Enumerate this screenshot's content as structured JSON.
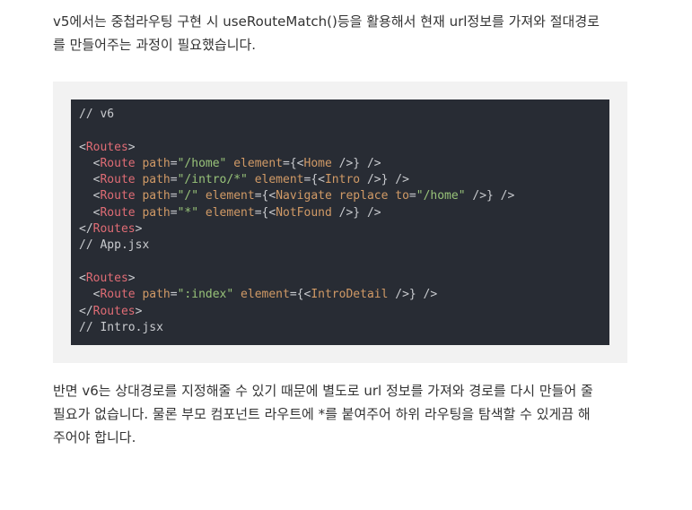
{
  "paragraph_top": {
    "lines": [
      "v5에서는 중첩라우팅 구현 시 useRouteMatch()등을 활용해서 현재 url정보를 가져와 절대경로",
      "를 만들어주는 과정이 필요했습니다."
    ]
  },
  "code": {
    "lines": [
      [
        {
          "t": "comment",
          "v": "// v6"
        }
      ],
      [],
      [
        {
          "t": "punct",
          "v": "<"
        },
        {
          "t": "tag",
          "v": "Routes"
        },
        {
          "t": "punct",
          "v": ">"
        }
      ],
      [
        {
          "t": "punct",
          "v": "  <"
        },
        {
          "t": "tag",
          "v": "Route"
        },
        {
          "t": "punct",
          "v": " "
        },
        {
          "t": "attr",
          "v": "path"
        },
        {
          "t": "punct",
          "v": "="
        },
        {
          "t": "str",
          "v": "\"/home\""
        },
        {
          "t": "punct",
          "v": " "
        },
        {
          "t": "attr",
          "v": "element"
        },
        {
          "t": "punct",
          "v": "={<"
        },
        {
          "t": "attr",
          "v": "Home"
        },
        {
          "t": "punct",
          "v": " />} />"
        }
      ],
      [
        {
          "t": "punct",
          "v": "  <"
        },
        {
          "t": "tag",
          "v": "Route"
        },
        {
          "t": "punct",
          "v": " "
        },
        {
          "t": "attr",
          "v": "path"
        },
        {
          "t": "punct",
          "v": "="
        },
        {
          "t": "str",
          "v": "\"/intro/*\""
        },
        {
          "t": "punct",
          "v": " "
        },
        {
          "t": "attr",
          "v": "element"
        },
        {
          "t": "punct",
          "v": "={<"
        },
        {
          "t": "attr",
          "v": "Intro"
        },
        {
          "t": "punct",
          "v": " />} />"
        }
      ],
      [
        {
          "t": "punct",
          "v": "  <"
        },
        {
          "t": "tag",
          "v": "Route"
        },
        {
          "t": "punct",
          "v": " "
        },
        {
          "t": "attr",
          "v": "path"
        },
        {
          "t": "punct",
          "v": "="
        },
        {
          "t": "str",
          "v": "\"/\""
        },
        {
          "t": "punct",
          "v": " "
        },
        {
          "t": "attr",
          "v": "element"
        },
        {
          "t": "punct",
          "v": "={<"
        },
        {
          "t": "attr",
          "v": "Navigate"
        },
        {
          "t": "punct",
          "v": " "
        },
        {
          "t": "attr",
          "v": "replace"
        },
        {
          "t": "punct",
          "v": " "
        },
        {
          "t": "attr",
          "v": "to"
        },
        {
          "t": "punct",
          "v": "="
        },
        {
          "t": "str",
          "v": "\"/home\""
        },
        {
          "t": "punct",
          "v": " />} />"
        }
      ],
      [
        {
          "t": "punct",
          "v": "  <"
        },
        {
          "t": "tag",
          "v": "Route"
        },
        {
          "t": "punct",
          "v": " "
        },
        {
          "t": "attr",
          "v": "path"
        },
        {
          "t": "punct",
          "v": "="
        },
        {
          "t": "str",
          "v": "\"*\""
        },
        {
          "t": "punct",
          "v": " "
        },
        {
          "t": "attr",
          "v": "element"
        },
        {
          "t": "punct",
          "v": "={<"
        },
        {
          "t": "attr",
          "v": "NotFound"
        },
        {
          "t": "punct",
          "v": " />} />"
        }
      ],
      [
        {
          "t": "punct",
          "v": "</"
        },
        {
          "t": "tag",
          "v": "Routes"
        },
        {
          "t": "punct",
          "v": ">"
        }
      ],
      [
        {
          "t": "comment",
          "v": "// App.jsx"
        }
      ],
      [],
      [
        {
          "t": "punct",
          "v": "<"
        },
        {
          "t": "tag",
          "v": "Routes"
        },
        {
          "t": "punct",
          "v": ">"
        }
      ],
      [
        {
          "t": "punct",
          "v": "  <"
        },
        {
          "t": "tag",
          "v": "Route"
        },
        {
          "t": "punct",
          "v": " "
        },
        {
          "t": "attr",
          "v": "path"
        },
        {
          "t": "punct",
          "v": "="
        },
        {
          "t": "str",
          "v": "\":index\""
        },
        {
          "t": "punct",
          "v": " "
        },
        {
          "t": "attr",
          "v": "element"
        },
        {
          "t": "punct",
          "v": "={<"
        },
        {
          "t": "attr",
          "v": "IntroDetail"
        },
        {
          "t": "punct",
          "v": " />} />"
        }
      ],
      [
        {
          "t": "punct",
          "v": "</"
        },
        {
          "t": "tag",
          "v": "Routes"
        },
        {
          "t": "punct",
          "v": ">"
        }
      ],
      [
        {
          "t": "comment",
          "v": "// Intro.jsx"
        }
      ]
    ]
  },
  "paragraph_bottom": {
    "lines": [
      "반면 v6는 상대경로를 지정해줄 수 있기 때문에 별도로 url 정보를 가져와 경로를 다시 만들어 줄",
      "필요가 없습니다. 물론 부모 컴포넌트 라우트에 *를 붙여주어 하위 라우팅을 탐색할 수 있게끔 해",
      "주어야 합니다."
    ]
  },
  "colors": {
    "code_background": "#282c34",
    "code_frame": "#f2f2f2",
    "tag": "#e06c75",
    "attr": "#d19a66",
    "string": "#98c379",
    "text": "#333333"
  }
}
